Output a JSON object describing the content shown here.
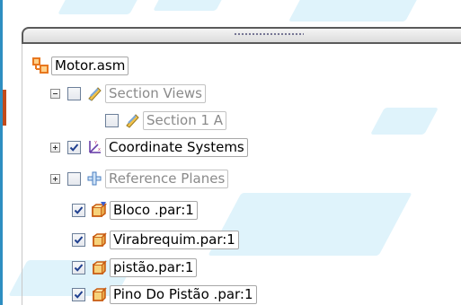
{
  "tree": {
    "root_label": "Motor.asm",
    "items": [
      {
        "label": "Section Views",
        "checked": false,
        "expander": "minus"
      },
      {
        "label": "Section 1 A",
        "checked": false
      },
      {
        "label": "Coordinate Systems",
        "checked": true,
        "expander": "plus"
      },
      {
        "label": "Reference Planes",
        "checked": false,
        "expander": "plus"
      },
      {
        "label": "Bloco .par:1",
        "checked": true
      },
      {
        "label": "Virabrequim.par:1",
        "checked": true
      },
      {
        "label": "pistão.par:1",
        "checked": true
      },
      {
        "label": "Pino Do Pistão .par:1",
        "checked": true
      }
    ]
  },
  "icons": {
    "assembly": "assembly-icon",
    "section": "section-view-icon",
    "coordinate": "coordinate-system-icon",
    "reference": "reference-plane-icon",
    "part_active": "part-active-icon",
    "part": "part-icon"
  },
  "colors": {
    "assembly_icon": "#e8771f",
    "part_icon": "#c85a10",
    "check": "#1f3f8f",
    "disabled_text": "#8a8a8a",
    "watermark": "#dff3fb"
  }
}
